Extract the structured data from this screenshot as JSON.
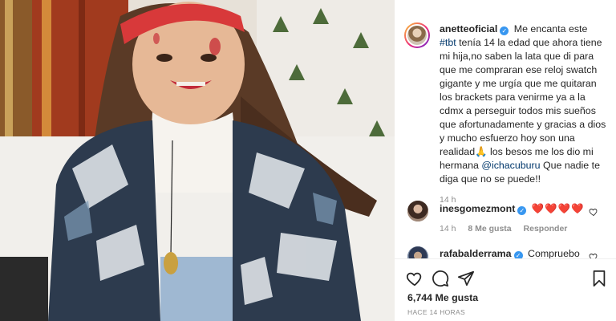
{
  "post": {
    "username": "anetteoficial",
    "caption_pre": "Me encanta este ",
    "hashtag": "#tbt",
    "caption_mid": " tenía 14 la edad que ahora tiene mi hija,no saben la lata que di para que me compraran ese reloj swatch gigante y me urgía que me quitaran los brackets para venirme ya a la cdmx a perseguir todos mis sueños que afortunadamente y gracias a dios y mucho esfuerzo hoy son una realidad🙏 los besos me los dio mi hermana ",
    "mention": "@ichacuburu",
    "caption_post": " Que nadie te diga que no se puede!!",
    "caption_time": "14 h"
  },
  "comments": [
    {
      "username": "inesgomezmont",
      "text": "❤️❤️❤️❤️",
      "time": "14 h",
      "likes": "8 Me gusta",
      "reply": "Responder"
    },
    {
      "username": "rafabalderrama",
      "text": "Compruebo el"
    }
  ],
  "footer": {
    "likes": "6,744 Me gusta",
    "posted": "HACE 14 HORAS"
  },
  "icons": {
    "like": "heart-outline",
    "comment": "speech-bubble",
    "share": "paper-plane",
    "save": "bookmark",
    "verified": "verified-badge"
  },
  "colors": {
    "verified": "#3897f0",
    "link": "#00376b",
    "heart": "#ed4956",
    "muted": "#8e8e8e"
  }
}
